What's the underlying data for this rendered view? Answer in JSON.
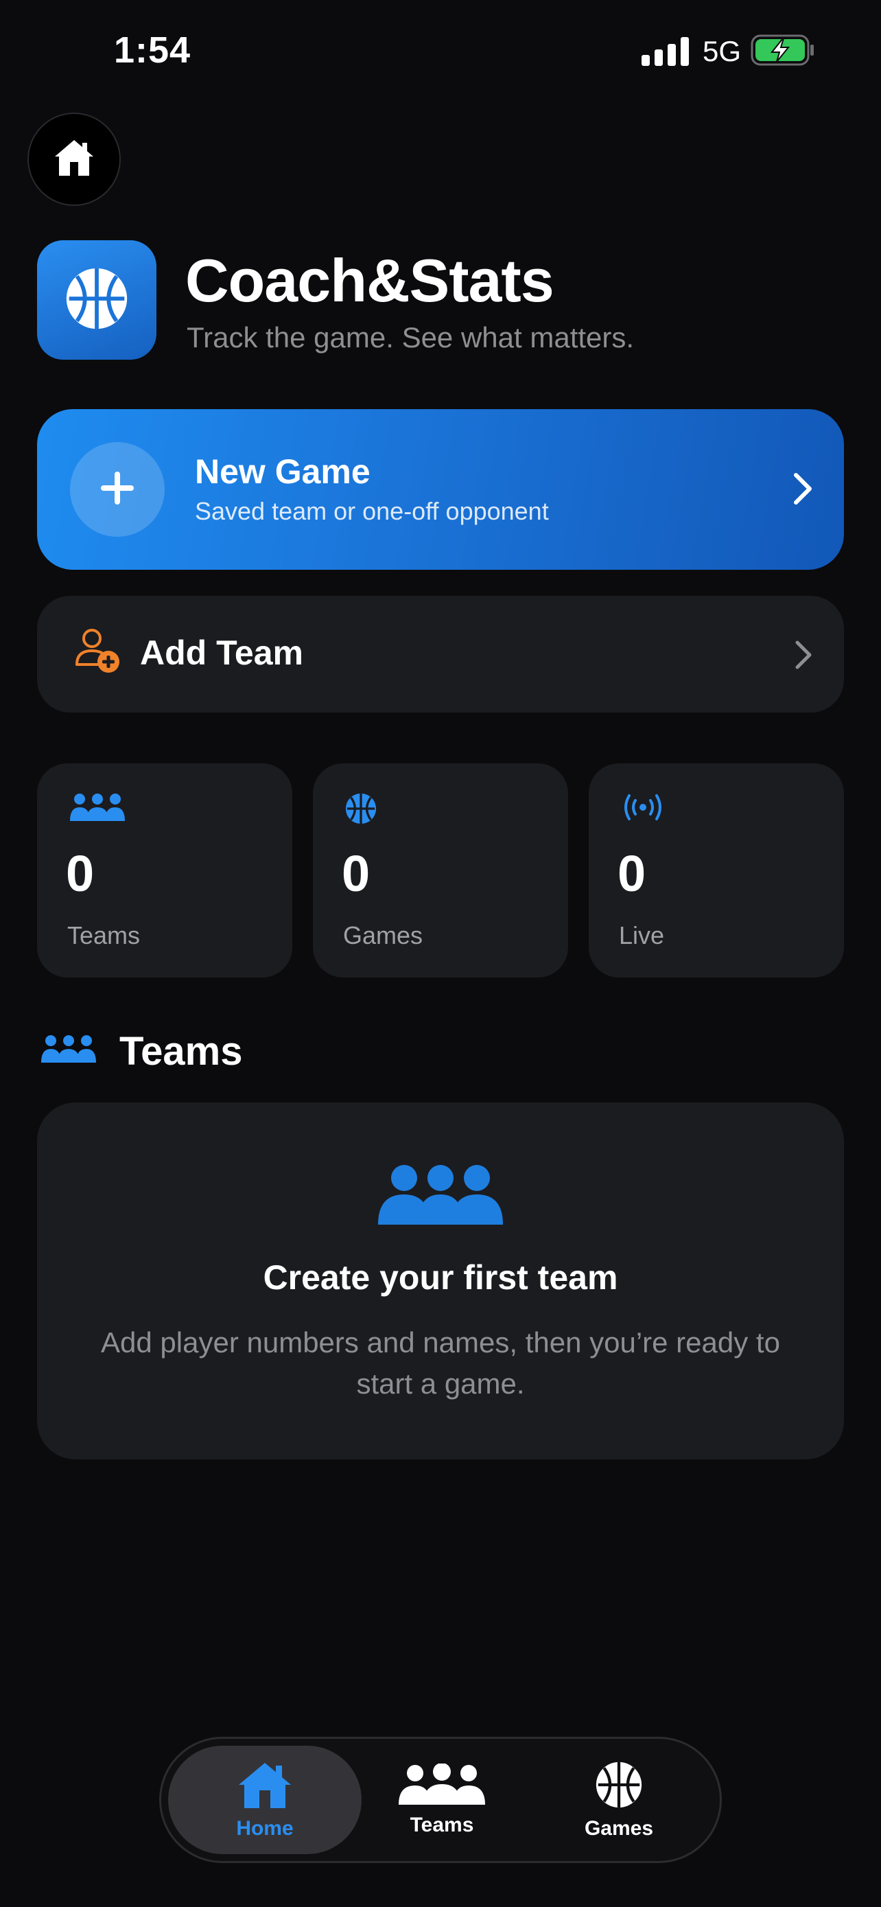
{
  "status_bar": {
    "time": "1:54",
    "network": "5G"
  },
  "header": {
    "title": "Coach&Stats",
    "subtitle": "Track the game. See what matters."
  },
  "new_game": {
    "title": "New Game",
    "subtitle": "Saved team or one-off opponent"
  },
  "add_team": {
    "label": "Add Team"
  },
  "stats": [
    {
      "value": "0",
      "label": "Teams",
      "icon": "people-icon"
    },
    {
      "value": "0",
      "label": "Games",
      "icon": "basketball-icon"
    },
    {
      "value": "0",
      "label": "Live",
      "icon": "broadcast-icon"
    }
  ],
  "teams_section": {
    "title": "Teams",
    "empty_title": "Create your first team",
    "empty_description": "Add player numbers and names, then you’re ready to start a game."
  },
  "tab_bar": {
    "items": [
      {
        "label": "Home",
        "icon": "house-icon",
        "active": true
      },
      {
        "label": "Teams",
        "icon": "people-icon",
        "active": false
      },
      {
        "label": "Games",
        "icon": "basketball-icon",
        "active": false
      }
    ]
  },
  "colors": {
    "background": "#0b0b0d",
    "card": "#1b1c20",
    "accent": "#2a8ef0",
    "add_team_icon": "#f0822a",
    "battery": "#34c759"
  }
}
